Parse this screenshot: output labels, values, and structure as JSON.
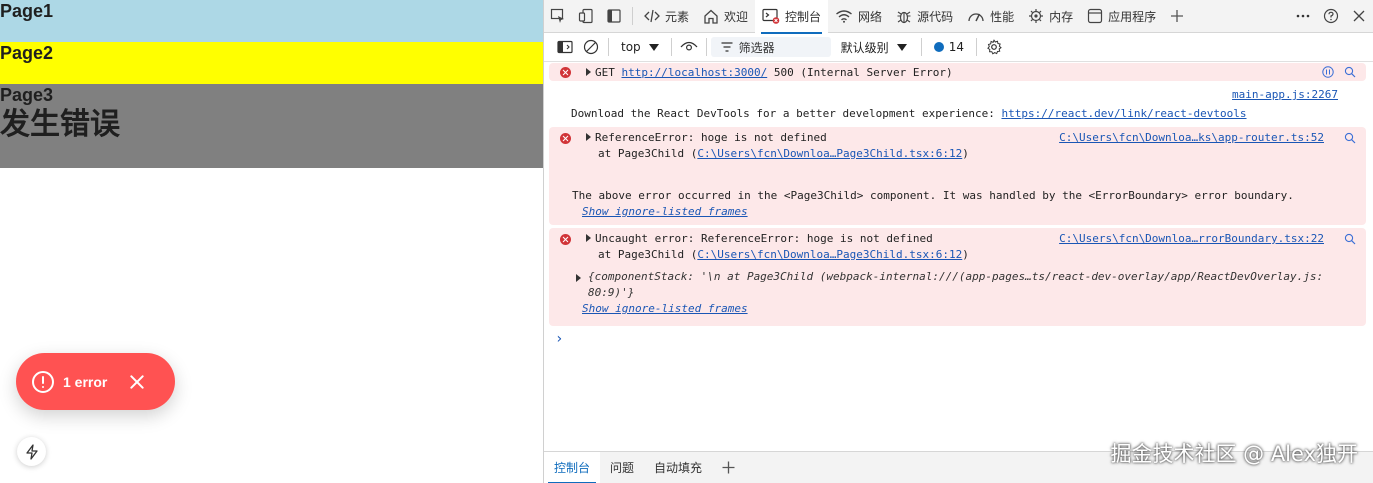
{
  "app": {
    "page1": "Page1",
    "page2": "Page2",
    "page3": "Page3",
    "error_heading": "发生错误",
    "error_pill": "1 error"
  },
  "devtools": {
    "tabs": [
      "元素",
      "欢迎",
      "控制台",
      "网络",
      "源代码",
      "性能",
      "内存",
      "应用程序"
    ],
    "toolbar": {
      "context": "top",
      "filter_placeholder": "筛选器",
      "level": "默认级别",
      "issues_count": "14"
    },
    "console": {
      "msg1": {
        "method": "GET",
        "url": "http://localhost:3000/",
        "status": "500 (Internal Server Error)"
      },
      "info": {
        "source": "main-app.js:2267",
        "text": "Download the React DevTools for a better development experience:",
        "url": "https://react.dev/link/react-devtools"
      },
      "msg2": {
        "text": "ReferenceError: hoge is not defined",
        "at_prefix": "at Page3Child (",
        "at_link": "C:\\Users\\fcn\\Downloa…Page3Child.tsx:6:12",
        "at_suffix": ")",
        "source": "C:\\Users\\fcn\\Downloa…ks\\app-router.ts:52",
        "note": "The above error occurred in the <Page3Child> component. It was handled by the <ErrorBoundary> error boundary.",
        "show_frames": "Show ignore-listed frames"
      },
      "msg3": {
        "text": "Uncaught error: ReferenceError: hoge is not defined",
        "at_prefix": "at Page3Child (",
        "at_link": "C:\\Users\\fcn\\Downloa…Page3Child.tsx:6:12",
        "at_suffix": ")",
        "source": "C:\\Users\\fcn\\Downloa…rrorBoundary.tsx:22",
        "obj_line1": "{componentStack: '\\n    at Page3Child (webpack-internal:///(app-pages…ts/react-dev-overlay/app/ReactDevOverlay.js:",
        "obj_line2": "80:9)'}",
        "show_frames": "Show ignore-listed frames"
      }
    },
    "drawer_tabs": [
      "控制台",
      "问题",
      "自动填充"
    ]
  },
  "watermark": "掘金技术社区 @ Alex独开",
  "colors": {
    "page1_bg": "#add8e6",
    "page2_bg": "#ffff00",
    "page3_bg": "#808080",
    "error_pill": "#ff5252",
    "error_row_bg": "#fde8e9",
    "link": "#1a56b5",
    "accent": "#0f6cbd"
  }
}
